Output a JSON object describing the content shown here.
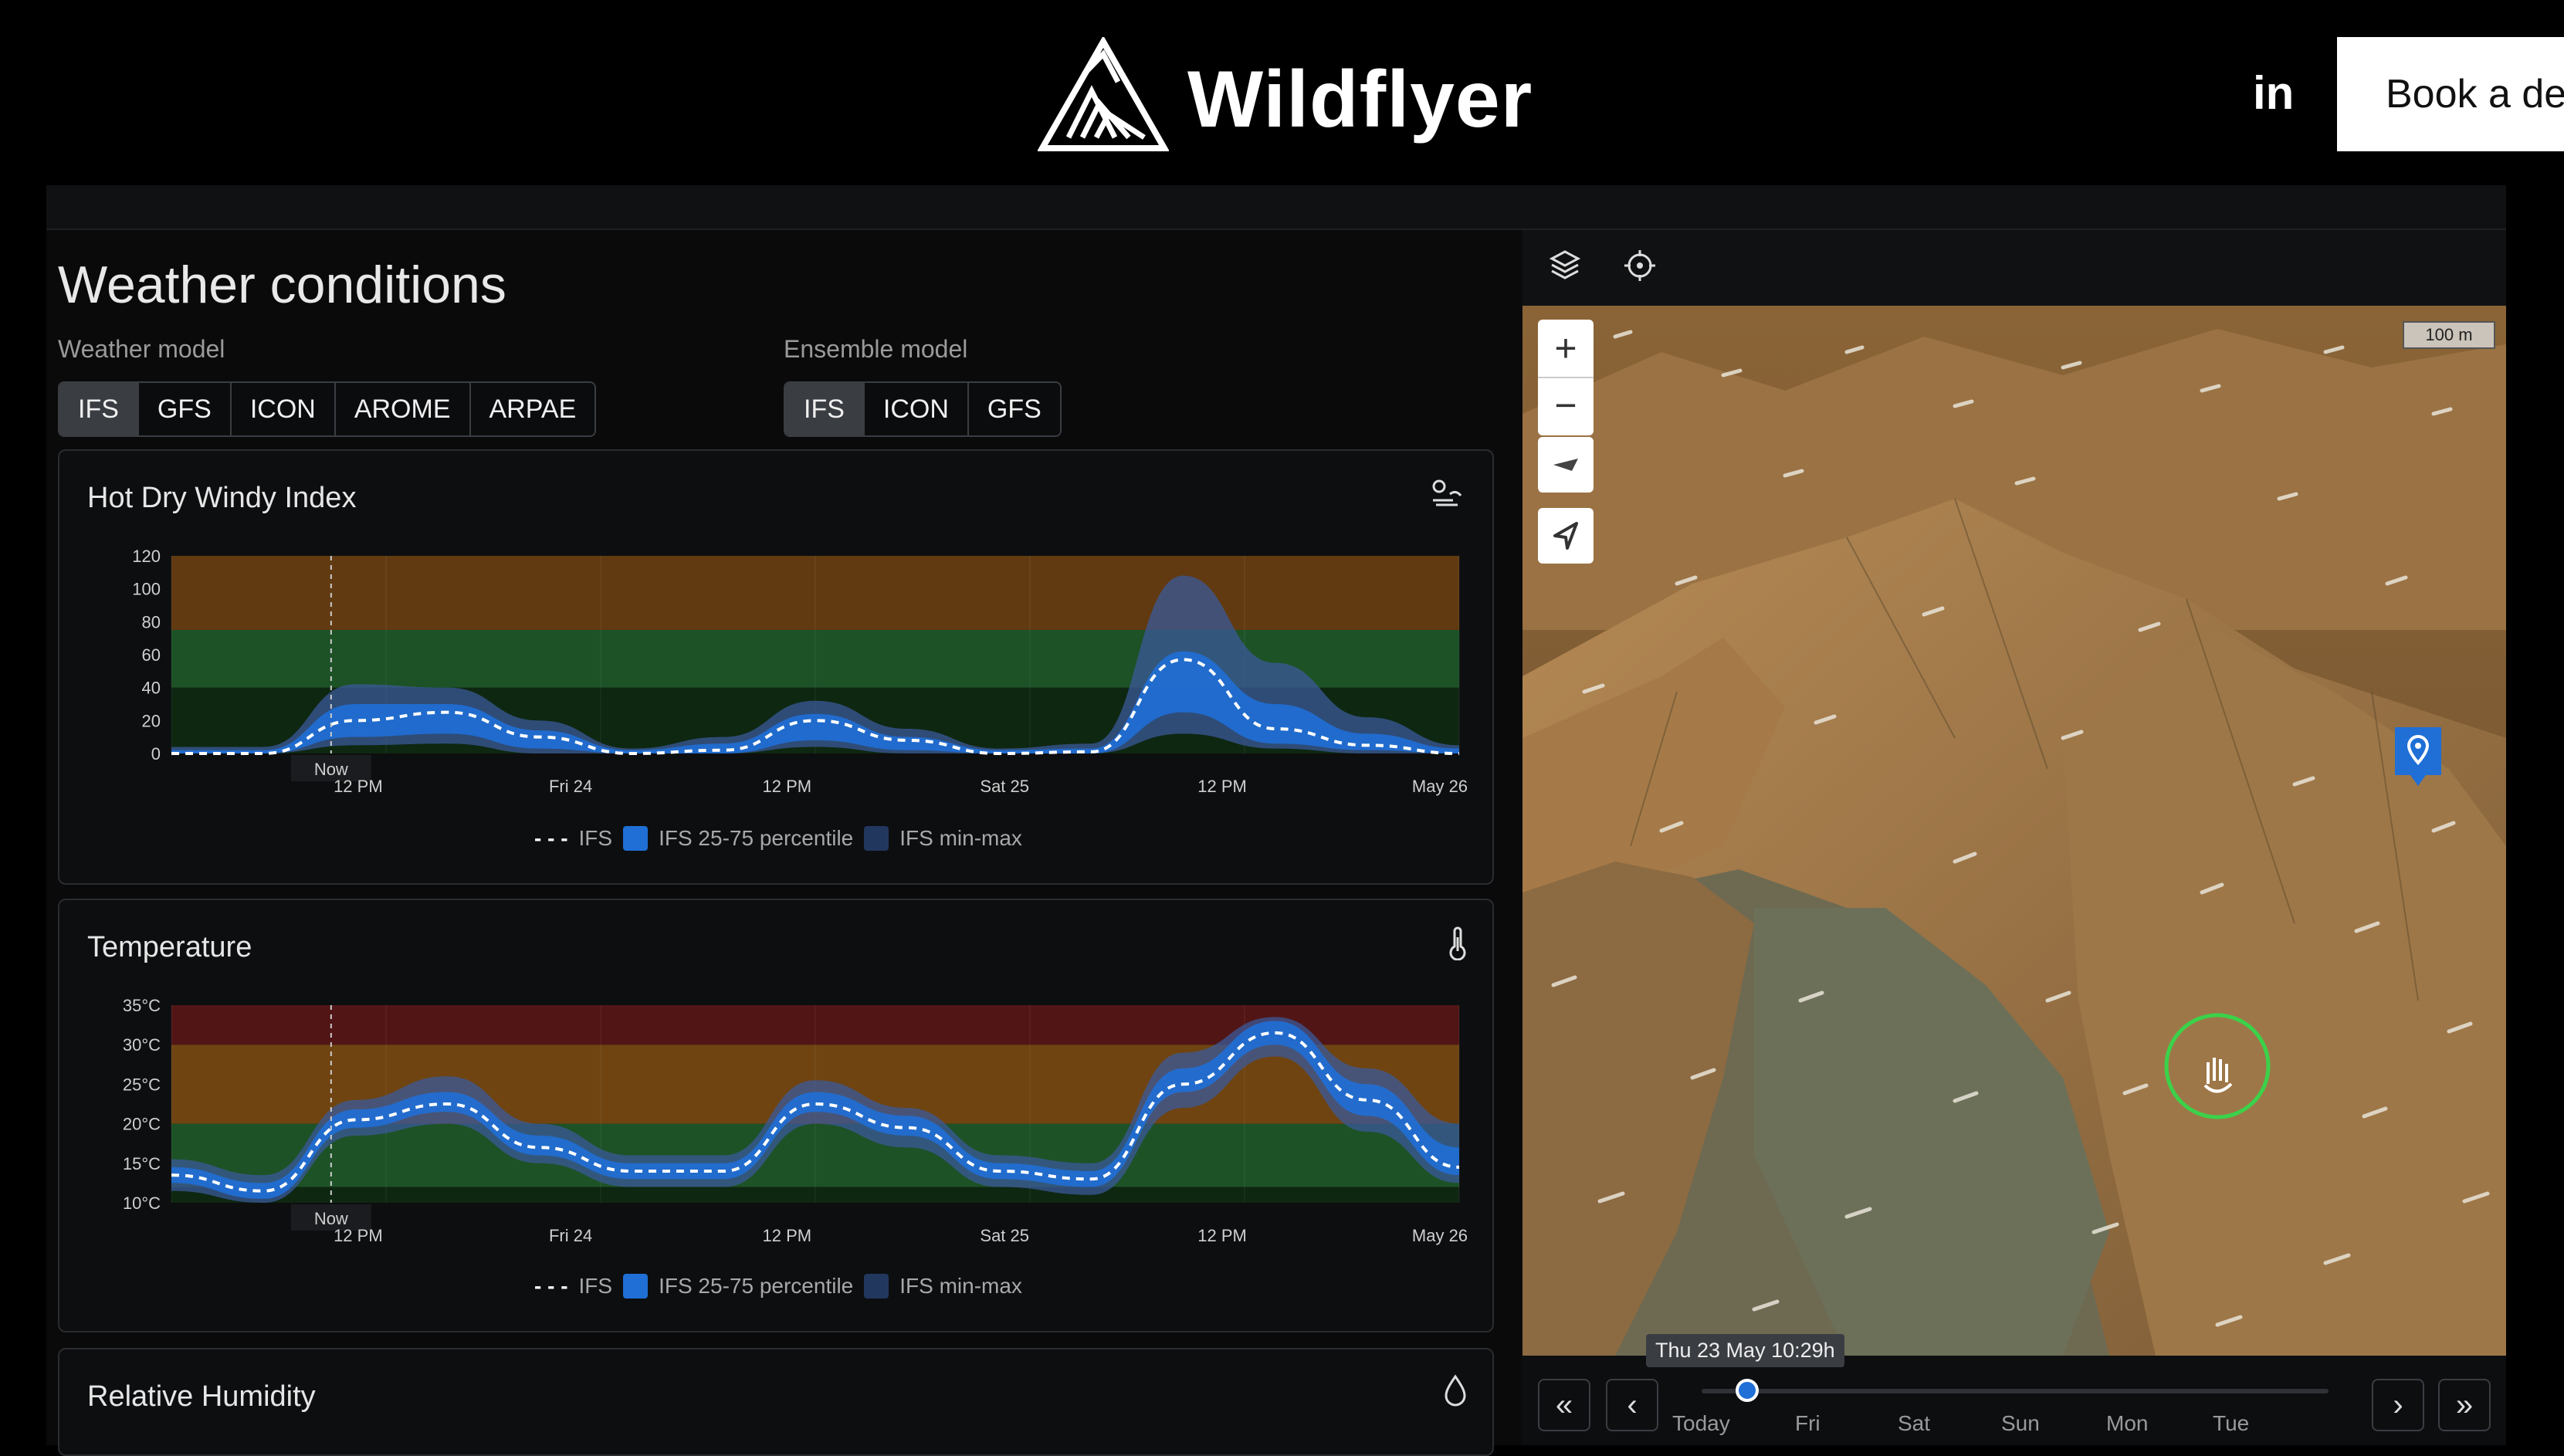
{
  "header": {
    "brand": "Wildflyer",
    "linkedin": "in",
    "cta": "Book a demo"
  },
  "page": {
    "title": "Weather conditions"
  },
  "weather_model": {
    "label": "Weather model",
    "options": [
      "IFS",
      "GFS",
      "ICON",
      "AROME",
      "ARPAE"
    ],
    "selected": "IFS"
  },
  "ensemble_model": {
    "label": "Ensemble model",
    "options": [
      "IFS",
      "ICON",
      "GFS"
    ],
    "selected": "IFS"
  },
  "legend": {
    "line": "IFS",
    "p2575": "IFS 25-75 percentile",
    "minmax": "IFS min-max"
  },
  "now_label": "Now",
  "x_ticks": [
    "12 PM",
    "Fri 24",
    "12 PM",
    "Sat 25",
    "12 PM",
    "May 26"
  ],
  "hdw": {
    "title": "Hot Dry Windy Index",
    "y_ticks": [
      "120",
      "100",
      "80",
      "60",
      "40",
      "20",
      "0"
    ]
  },
  "temp": {
    "title": "Temperature",
    "y_ticks": [
      "35°C",
      "30°C",
      "25°C",
      "20°C",
      "15°C",
      "10°C"
    ]
  },
  "humidity": {
    "title": "Relative Humidity"
  },
  "map": {
    "scale": "100 m"
  },
  "timeline": {
    "tooltip": "Thu 23 May 10:29h",
    "days": [
      "Today",
      "Fri",
      "Sat",
      "Sun",
      "Mon",
      "Tue"
    ]
  },
  "chart_data": [
    {
      "type": "area",
      "title": "Hot Dry Windy Index",
      "x": [
        "Thu 23 00h",
        "Thu 23 06h",
        "Thu 23 10h",
        "Thu 23 14h",
        "Thu 23 18h",
        "Fri 24 00h",
        "Fri 24 06h",
        "Fri 24 12h",
        "Fri 24 18h",
        "Sat 25 00h",
        "Sat 25 06h",
        "Sat 25 12h",
        "Sat 25 16h",
        "Sat 25 20h",
        "May 26 00h"
      ],
      "ylim": [
        0,
        120
      ],
      "bands": [
        {
          "from": 0,
          "to": 40,
          "color": "#0e2a12"
        },
        {
          "from": 40,
          "to": 75,
          "color": "#1f5a2a"
        },
        {
          "from": 75,
          "to": 120,
          "color": "#6a3f12"
        }
      ],
      "series": [
        {
          "name": "IFS",
          "values": [
            0,
            0,
            20,
            25,
            10,
            0,
            2,
            20,
            8,
            0,
            1,
            57,
            15,
            5,
            0
          ]
        },
        {
          "name": "IFS 25-75 percentile",
          "values": [
            [
              0,
              2
            ],
            [
              0,
              2
            ],
            [
              10,
              30
            ],
            [
              12,
              30
            ],
            [
              3,
              14
            ],
            [
              0,
              2
            ],
            [
              0,
              6
            ],
            [
              8,
              24
            ],
            [
              2,
              10
            ],
            [
              0,
              2
            ],
            [
              0,
              3
            ],
            [
              25,
              62
            ],
            [
              6,
              30
            ],
            [
              2,
              12
            ],
            [
              0,
              3
            ]
          ]
        },
        {
          "name": "IFS min-max",
          "values": [
            [
              0,
              4
            ],
            [
              0,
              4
            ],
            [
              5,
              42
            ],
            [
              6,
              40
            ],
            [
              0,
              20
            ],
            [
              0,
              3
            ],
            [
              0,
              10
            ],
            [
              4,
              32
            ],
            [
              0,
              15
            ],
            [
              0,
              3
            ],
            [
              0,
              6
            ],
            [
              12,
              108
            ],
            [
              3,
              55
            ],
            [
              0,
              22
            ],
            [
              0,
              5
            ]
          ]
        }
      ]
    },
    {
      "type": "area",
      "title": "Temperature",
      "x": [
        "Thu 23 00h",
        "Thu 23 06h",
        "Thu 23 10h",
        "Thu 23 14h",
        "Thu 23 18h",
        "Fri 24 00h",
        "Fri 24 06h",
        "Fri 24 12h",
        "Fri 24 18h",
        "Sat 25 00h",
        "Sat 25 06h",
        "Sat 25 12h",
        "Sat 25 16h",
        "Sat 25 20h",
        "May 26 00h"
      ],
      "ylim": [
        10,
        35
      ],
      "bands": [
        {
          "from": 10,
          "to": 12,
          "color": "#0e2a12"
        },
        {
          "from": 12,
          "to": 20,
          "color": "#1f5a2a"
        },
        {
          "from": 20,
          "to": 30,
          "color": "#7a4a12"
        },
        {
          "from": 30,
          "to": 35,
          "color": "#5a1616"
        }
      ],
      "series": [
        {
          "name": "IFS",
          "values": [
            13.5,
            11.5,
            20.5,
            22.5,
            17,
            14,
            14,
            22.5,
            19.5,
            14,
            13,
            25,
            31.5,
            23,
            14.5
          ]
        },
        {
          "name": "IFS 25-75 percentile",
          "values": [
            [
              12.5,
              14.5
            ],
            [
              10.5,
              12.5
            ],
            [
              19.5,
              21.8
            ],
            [
              21.5,
              24
            ],
            [
              16,
              18.5
            ],
            [
              13,
              15
            ],
            [
              13,
              15
            ],
            [
              21.5,
              24
            ],
            [
              18.5,
              21
            ],
            [
              13,
              15
            ],
            [
              12,
              14
            ],
            [
              24,
              27
            ],
            [
              30,
              33
            ],
            [
              21,
              25
            ],
            [
              13.5,
              17
            ]
          ]
        },
        {
          "name": "IFS min-max",
          "values": [
            [
              11.5,
              15.5
            ],
            [
              10,
              13.5
            ],
            [
              18.5,
              23
            ],
            [
              20,
              26
            ],
            [
              15,
              20
            ],
            [
              12,
              16
            ],
            [
              12,
              16
            ],
            [
              20,
              25.5
            ],
            [
              17,
              22
            ],
            [
              12,
              16
            ],
            [
              11,
              15
            ],
            [
              22,
              29
            ],
            [
              28.5,
              33.5
            ],
            [
              19,
              27
            ],
            [
              12.5,
              20
            ]
          ]
        }
      ]
    }
  ]
}
